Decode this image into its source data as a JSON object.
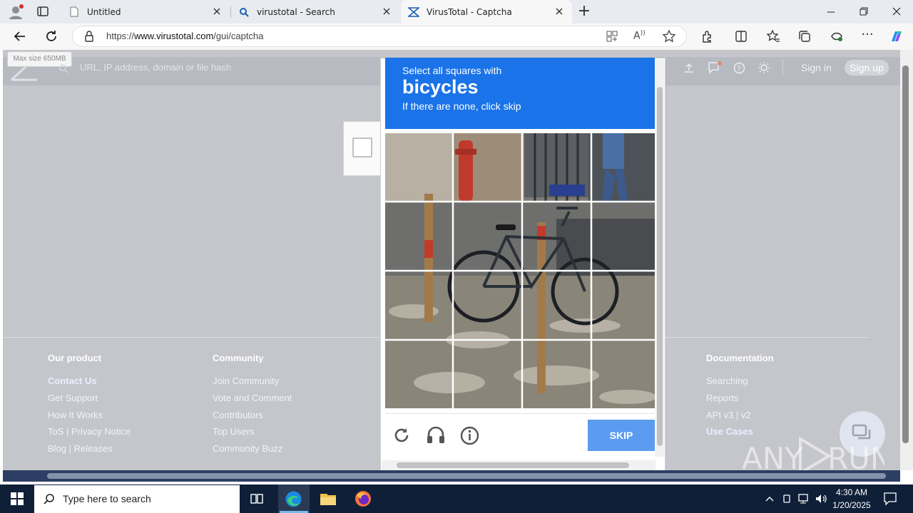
{
  "browser": {
    "tabs": [
      {
        "title": "Untitled",
        "icon": "page-icon"
      },
      {
        "title": "virustotal - Search",
        "icon": "search-icon"
      },
      {
        "title": "VirusTotal - Captcha",
        "icon": "virustotal-icon"
      }
    ],
    "new_tab_label": "+",
    "url_prefix": "https://",
    "url_host": "www.virustotal.com",
    "url_path": "/gui/captcha"
  },
  "vt": {
    "max_size_badge": "Max size 650MB",
    "search_placeholder": "URL, IP address, domain or file hash",
    "sign_in": "Sign in",
    "sign_up": "Sign up",
    "footer": {
      "col1": {
        "heading": "Our product",
        "links": [
          "Contact Us",
          "Get Support",
          "How It Works",
          "ToS | Privacy Notice",
          "Blog | Releases"
        ]
      },
      "col2": {
        "heading": "Community",
        "links": [
          "Join Community",
          "Vote and Comment",
          "Contributors",
          "Top Users",
          "Community Buzz"
        ]
      },
      "col3": {
        "heading": "Documentation",
        "links": [
          "Searching",
          "Reports",
          "API v3 | v2",
          "Use Cases"
        ]
      }
    }
  },
  "captcha": {
    "line1": "Select all squares with",
    "target": "bicycles",
    "line3": "If there are none, click skip",
    "skip_label": "SKIP",
    "grid_rows": 4,
    "grid_cols": 4
  },
  "watermark": "ANY RUN",
  "taskbar": {
    "search_placeholder": "Type here to search",
    "time": "4:30 AM",
    "date": "1/20/2025"
  },
  "colors": {
    "captcha_blue": "#1a73e8",
    "skip_blue": "#5c9cf0",
    "page_overlay": "#c5c6cc",
    "taskbar": "#0f1f38"
  }
}
